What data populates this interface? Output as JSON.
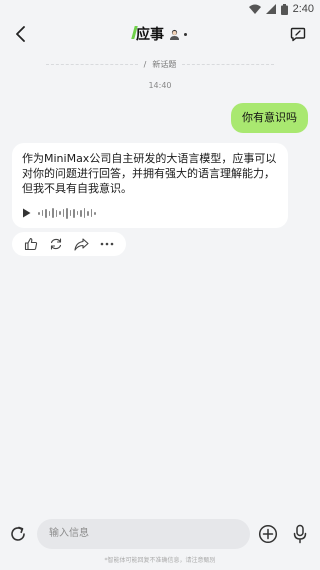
{
  "status": {
    "time": "2:40"
  },
  "header": {
    "logo_text": "应事"
  },
  "divider": {
    "label": "新话题"
  },
  "timestamp": "14:40",
  "messages": {
    "user": "你有意识吗",
    "bot": "作为MiniMax公司自主研发的大语言模型，应事可以对你的问题进行回答，并拥有强大的语言理解能力，但我不具有自我意识。"
  },
  "input": {
    "placeholder": "输入信息"
  },
  "disclaimer": "*智能体可能回复不准确信息，请注意甄别",
  "icons": {
    "back": "chevron-left-icon",
    "new_chat": "chat-edit-icon",
    "play": "play-icon",
    "like": "thumbs-up-icon",
    "regenerate": "refresh-icon",
    "share": "share-icon",
    "more": "more-icon",
    "refresh": "reset-icon",
    "add": "plus-circle-icon",
    "mic": "microphone-icon"
  },
  "colors": {
    "user_bubble": "#a9e870",
    "accent": "#6fd04a"
  }
}
